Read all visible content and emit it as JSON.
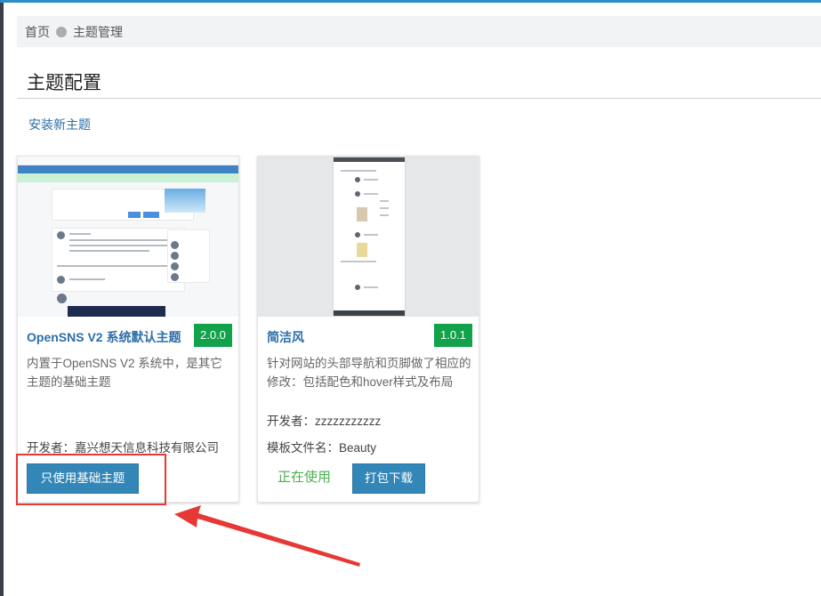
{
  "breadcrumb": {
    "home": "首页",
    "current": "主题管理"
  },
  "page": {
    "title": "主题配置",
    "install_link": "安装新主题"
  },
  "themes": [
    {
      "name": "OpenSNS V2 系统默认主题",
      "version": "2.0.0",
      "description": "内置于OpenSNS V2 系统中，是其它主题的基础主题",
      "developer": "开发者：嘉兴想天信息科技有限公司",
      "button": "只使用基础主题"
    },
    {
      "name": "简洁风",
      "version": "1.0.1",
      "description": "针对网站的头部导航和页脚做了相应的修改：包括配色和hover样式及布局",
      "developer": "开发者：zzzzzzzzzzz",
      "template_file": "模板文件名：Beauty",
      "status": "正在使用",
      "button": "打包下载"
    }
  ],
  "colors": {
    "accent": "#2d6ea8",
    "version_badge": "#13a24c",
    "button": "#3387b8",
    "in_use": "#4caf50",
    "annotation": "#e53935"
  }
}
